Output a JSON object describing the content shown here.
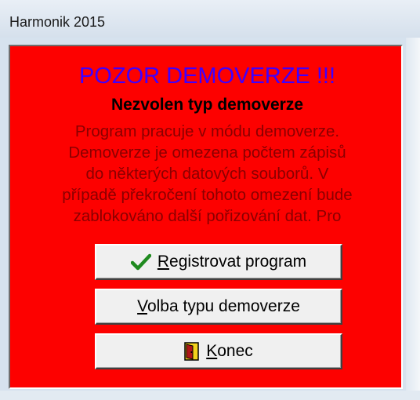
{
  "window": {
    "title": "Harmonik 2015"
  },
  "dialog": {
    "heading": "POZOR DEMOVERZE !!!",
    "subheading": "Nezvolen typ demoverze",
    "message_lines": [
      "Program pracuje v módu demoverze.",
      "Demoverze je omezena počtem zápisů",
      "do některých datových souborů. V",
      "případě překročení tohoto omezení bude",
      "zablokováno další pořizování dat. Pro"
    ],
    "colors": {
      "background": "#fd0100",
      "heading": "#3f00ff",
      "message": "#8a0000"
    }
  },
  "buttons": {
    "register": {
      "label": "Registrovat program",
      "icon": "checkmark-icon",
      "mnemonic": "R"
    },
    "demo_type": {
      "label": "Volba typu demoverze",
      "mnemonic": "V"
    },
    "exit": {
      "label": "Konec",
      "icon": "exit-door-icon",
      "mnemonic": "K"
    }
  }
}
